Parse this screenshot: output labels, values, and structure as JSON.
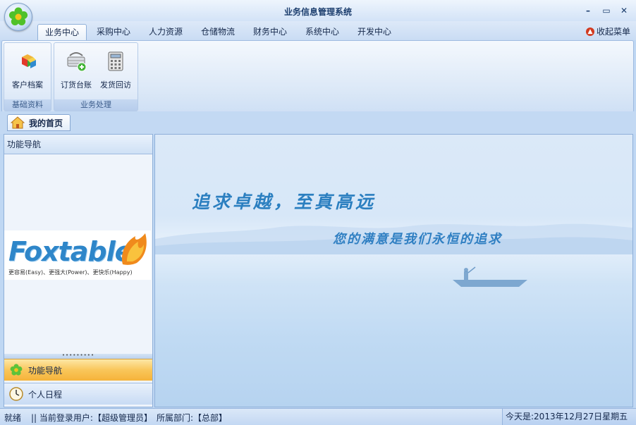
{
  "window": {
    "title": "业务信息管理系统",
    "controls": {
      "minimize": "–",
      "maximize": "▭",
      "close": "✕"
    }
  },
  "menu": {
    "tabs": [
      "业务中心",
      "采购中心",
      "人力资源",
      "仓储物流",
      "财务中心",
      "系统中心",
      "开发中心"
    ],
    "active_index": 0,
    "collapse_label": "收起菜单"
  },
  "ribbon": {
    "groups": [
      {
        "label": "基础资料",
        "buttons": [
          {
            "label": "客户档案",
            "icon": "customer-cube-icon"
          }
        ]
      },
      {
        "label": "业务处理",
        "buttons": [
          {
            "label": "订货台账",
            "icon": "basket-add-icon"
          },
          {
            "label": "发货回访",
            "icon": "telephone-icon"
          }
        ]
      }
    ]
  },
  "document_tabs": [
    {
      "label": "我的首页",
      "icon": "home-icon"
    }
  ],
  "left_panel": {
    "header": "功能导航",
    "logo": {
      "text": "Foxtable",
      "tagline": "更容易(Easy)、更强大(Power)、更快乐(Happy)"
    },
    "nav_buttons": [
      {
        "label": "功能导航",
        "icon": "flower-icon",
        "active": true
      },
      {
        "label": "个人日程",
        "icon": "clock-icon",
        "active": false
      }
    ]
  },
  "main": {
    "slogan_primary": "追求卓越，至真高远",
    "slogan_secondary": "您的满意是我们永恒的追求"
  },
  "status": {
    "state": "就绪",
    "user_label": "|| 当前登录用户:【超级管理员】",
    "dept_label": "所属部门:【总部】",
    "date": "今天是:2013年12月27日星期五"
  },
  "colors": {
    "accent_orange": "#f9c65a",
    "ribbon_border": "#9fbbe0",
    "slogan_blue": "#2b7fc0"
  }
}
